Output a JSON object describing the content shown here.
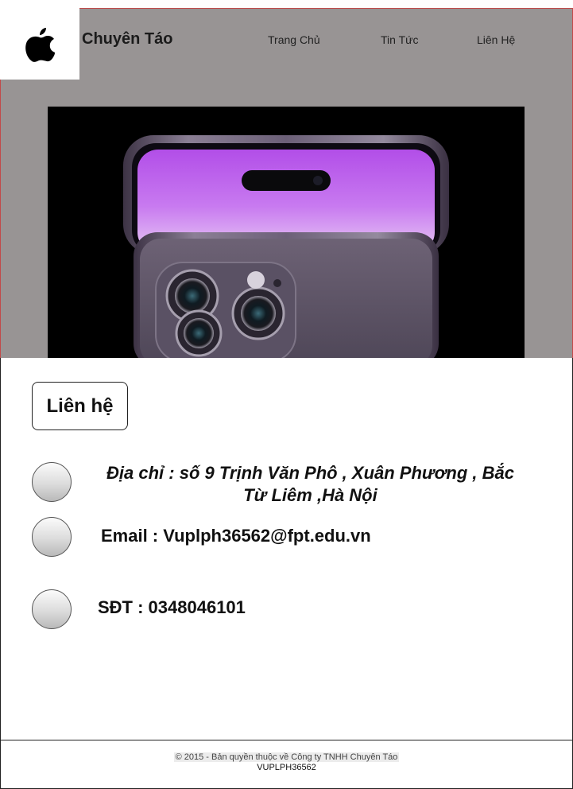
{
  "header": {
    "brand": "Chuyên Táo",
    "logo_icon": "apple-logo-icon",
    "nav": [
      {
        "label": "Trang Chủ"
      },
      {
        "label": "Tin Tức"
      },
      {
        "label": "Liên Hệ"
      }
    ],
    "background_color": "#989494"
  },
  "hero": {
    "image_subject": "iphone-14-pro-deep-purple"
  },
  "contact": {
    "heading": "Liên hệ",
    "address": "Địa chỉ : số 9 Trịnh Văn Phô , Xuân Phương , Bắc Từ Liêm ,Hà Nội",
    "email": "Email : Vuplph36562@fpt.edu.vn",
    "phone": "SĐT : 0348046101"
  },
  "footer": {
    "copyright": "© 2015 - Bản quyền thuộc về Công ty TNHH Chuyên Táo",
    "author_id": "VUPLPH36562"
  }
}
